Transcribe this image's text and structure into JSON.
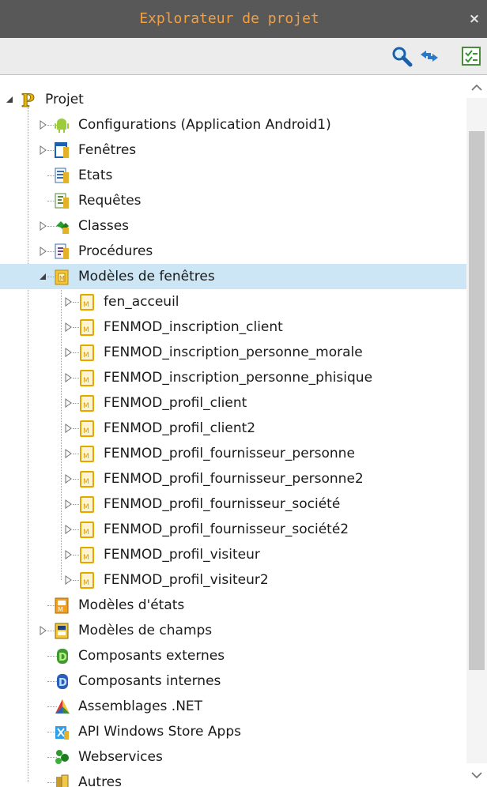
{
  "panel": {
    "title": "Explorateur de projet",
    "close_label": "×"
  },
  "toolbar": {
    "buttons": [
      {
        "icon": "search-icon"
      },
      {
        "icon": "sync-arrows-icon"
      },
      {
        "icon": "checklist-icon"
      }
    ]
  },
  "tree": {
    "items": [
      {
        "label": "Projet",
        "level": 0,
        "expander": "expanded",
        "icon": "project-p-icon"
      },
      {
        "label": "Configurations (Application Android1)",
        "level": 1,
        "expander": "collapsed",
        "icon": "android-icon"
      },
      {
        "label": "Fenêtres",
        "level": 1,
        "expander": "collapsed",
        "icon": "window-icon"
      },
      {
        "label": "Etats",
        "level": 1,
        "expander": "none",
        "icon": "report-icon"
      },
      {
        "label": "Requêtes",
        "level": 1,
        "expander": "none",
        "icon": "query-icon"
      },
      {
        "label": "Classes",
        "level": 1,
        "expander": "collapsed",
        "icon": "class-icon"
      },
      {
        "label": "Procédures",
        "level": 1,
        "expander": "collapsed",
        "icon": "procedure-icon"
      },
      {
        "label": "Modèles de fenêtres",
        "level": 1,
        "expander": "expanded",
        "icon": "window-template-icon",
        "selected": true
      },
      {
        "label": "fen_acceuil",
        "level": 2,
        "expander": "collapsed",
        "icon": "template-m-icon"
      },
      {
        "label": "FENMOD_inscription_client",
        "level": 2,
        "expander": "collapsed",
        "icon": "template-m-icon"
      },
      {
        "label": "FENMOD_inscription_personne_morale",
        "level": 2,
        "expander": "collapsed",
        "icon": "template-m-icon"
      },
      {
        "label": "FENMOD_inscription_personne_phisique",
        "level": 2,
        "expander": "collapsed",
        "icon": "template-m-icon"
      },
      {
        "label": "FENMOD_profil_client",
        "level": 2,
        "expander": "collapsed",
        "icon": "template-m-icon"
      },
      {
        "label": "FENMOD_profil_client2",
        "level": 2,
        "expander": "collapsed",
        "icon": "template-m-icon"
      },
      {
        "label": "FENMOD_profil_fournisseur_personne",
        "level": 2,
        "expander": "collapsed",
        "icon": "template-m-icon"
      },
      {
        "label": "FENMOD_profil_fournisseur_personne2",
        "level": 2,
        "expander": "collapsed",
        "icon": "template-m-icon"
      },
      {
        "label": "FENMOD_profil_fournisseur_société",
        "level": 2,
        "expander": "collapsed",
        "icon": "template-m-icon"
      },
      {
        "label": "FENMOD_profil_fournisseur_société2",
        "level": 2,
        "expander": "collapsed",
        "icon": "template-m-icon"
      },
      {
        "label": "FENMOD_profil_visiteur",
        "level": 2,
        "expander": "collapsed",
        "icon": "template-m-icon"
      },
      {
        "label": "FENMOD_profil_visiteur2",
        "level": 2,
        "expander": "collapsed",
        "icon": "template-m-icon"
      },
      {
        "label": "Modèles d'états",
        "level": 1,
        "expander": "none",
        "icon": "report-template-icon"
      },
      {
        "label": "Modèles de champs",
        "level": 1,
        "expander": "collapsed",
        "icon": "field-template-icon"
      },
      {
        "label": "Composants externes",
        "level": 1,
        "expander": "none",
        "icon": "external-component-icon"
      },
      {
        "label": "Composants internes",
        "level": 1,
        "expander": "none",
        "icon": "internal-component-icon"
      },
      {
        "label": "Assemblages .NET",
        "level": 1,
        "expander": "none",
        "icon": "dotnet-assembly-icon"
      },
      {
        "label": "API Windows Store Apps",
        "level": 1,
        "expander": "none",
        "icon": "windows-store-icon"
      },
      {
        "label": "Webservices",
        "level": 1,
        "expander": "none",
        "icon": "webservice-icon"
      },
      {
        "label": "Autres",
        "level": 1,
        "expander": "none",
        "icon": "folder-icon"
      }
    ]
  },
  "colors": {
    "title_bar": "#585858",
    "title_text": "#f0a044",
    "selection": "#cde6f5",
    "toolbar": "#ececec"
  }
}
